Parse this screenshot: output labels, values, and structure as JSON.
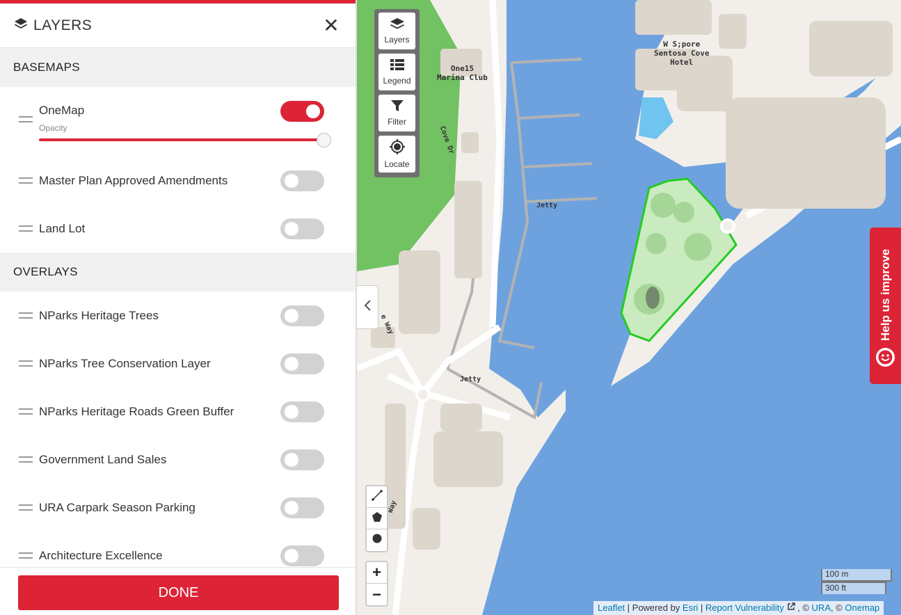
{
  "panel": {
    "title": "LAYERS",
    "close_label": "✕",
    "basemaps_title": "BASEMAPS",
    "overlays_title": "OVERLAYS",
    "done_label": "DONE",
    "basemaps": [
      {
        "label": "OneMap",
        "on": true,
        "opacity_label": "Opacity",
        "opacity": 1.0
      },
      {
        "label": "Master Plan Approved Amendments",
        "on": false
      },
      {
        "label": "Land Lot",
        "on": false
      }
    ],
    "overlays": [
      {
        "label": "NParks Heritage Trees",
        "on": false
      },
      {
        "label": "NParks Tree Conservation Layer",
        "on": false
      },
      {
        "label": "NParks Heritage Roads Green Buffer",
        "on": false
      },
      {
        "label": "Government Land Sales",
        "on": false
      },
      {
        "label": "URA Carpark Season Parking",
        "on": false
      },
      {
        "label": "Architecture Excellence",
        "on": false
      }
    ]
  },
  "toolbar": {
    "layers": "Layers",
    "legend": "Legend",
    "filter": "Filter",
    "locate": "Locate"
  },
  "zoom": {
    "in": "+",
    "out": "−"
  },
  "map": {
    "labels": {
      "one15": "One15\nMarina Club",
      "wsentosa": "W S;pore\nSentosa Cove\nHotel",
      "jetty1": "Jetty",
      "jetty2": "Jetty",
      "cove_dr": "Cove Dr",
      "way1": "e Way",
      "way2": "Way"
    },
    "scale_m": "100 m",
    "scale_ft": "300 ft"
  },
  "attribution": {
    "leaflet": "Leaflet",
    "sep1": " | Powered by ",
    "esri": "Esri",
    "sep2": " | ",
    "report": "Report Vulnerability",
    "sep3": " , © ",
    "ura": "URA",
    "sep4": ", © ",
    "onemap": "Onemap"
  },
  "help": {
    "label": "Help us improve"
  },
  "colors": {
    "accent": "#dc2436",
    "water": "#6ea2df",
    "land": "#f2efea",
    "park": "#72c162",
    "highlight": "#22cc22"
  }
}
